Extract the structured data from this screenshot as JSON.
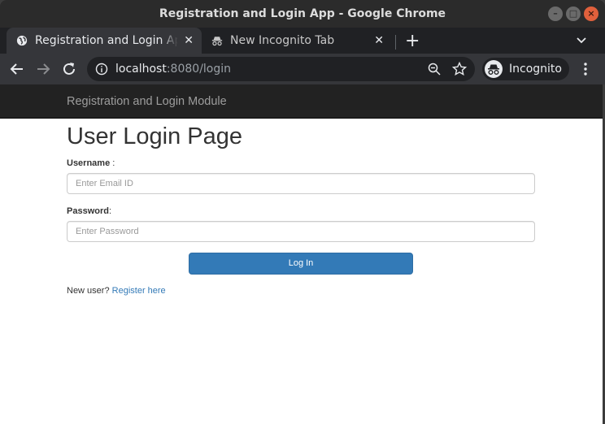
{
  "window": {
    "title": "Registration and Login App - Google Chrome"
  },
  "tabs": [
    {
      "label": "Registration and Login App",
      "active": true,
      "icon": "globe-icon"
    },
    {
      "label": "New Incognito Tab",
      "active": false,
      "icon": "incognito-icon"
    }
  ],
  "toolbar": {
    "url_host": "localhost",
    "url_rest": ":8080/login",
    "incognito_label": "Incognito"
  },
  "page": {
    "brand": "Registration and Login Module",
    "title": "User Login Page",
    "username_label": "Username",
    "username_suffix": " :",
    "username_placeholder": "Enter Email ID",
    "password_label": "Password",
    "password_suffix": ":",
    "password_placeholder": "Enter Password",
    "login_button": "Log In",
    "new_user_text": "New user? ",
    "register_link": "Register here"
  },
  "colors": {
    "navbar": "#222222",
    "primary_button": "#337ab7",
    "link": "#337ab7",
    "chrome_dark": "#202124",
    "chrome_toolbar": "#35363a"
  }
}
